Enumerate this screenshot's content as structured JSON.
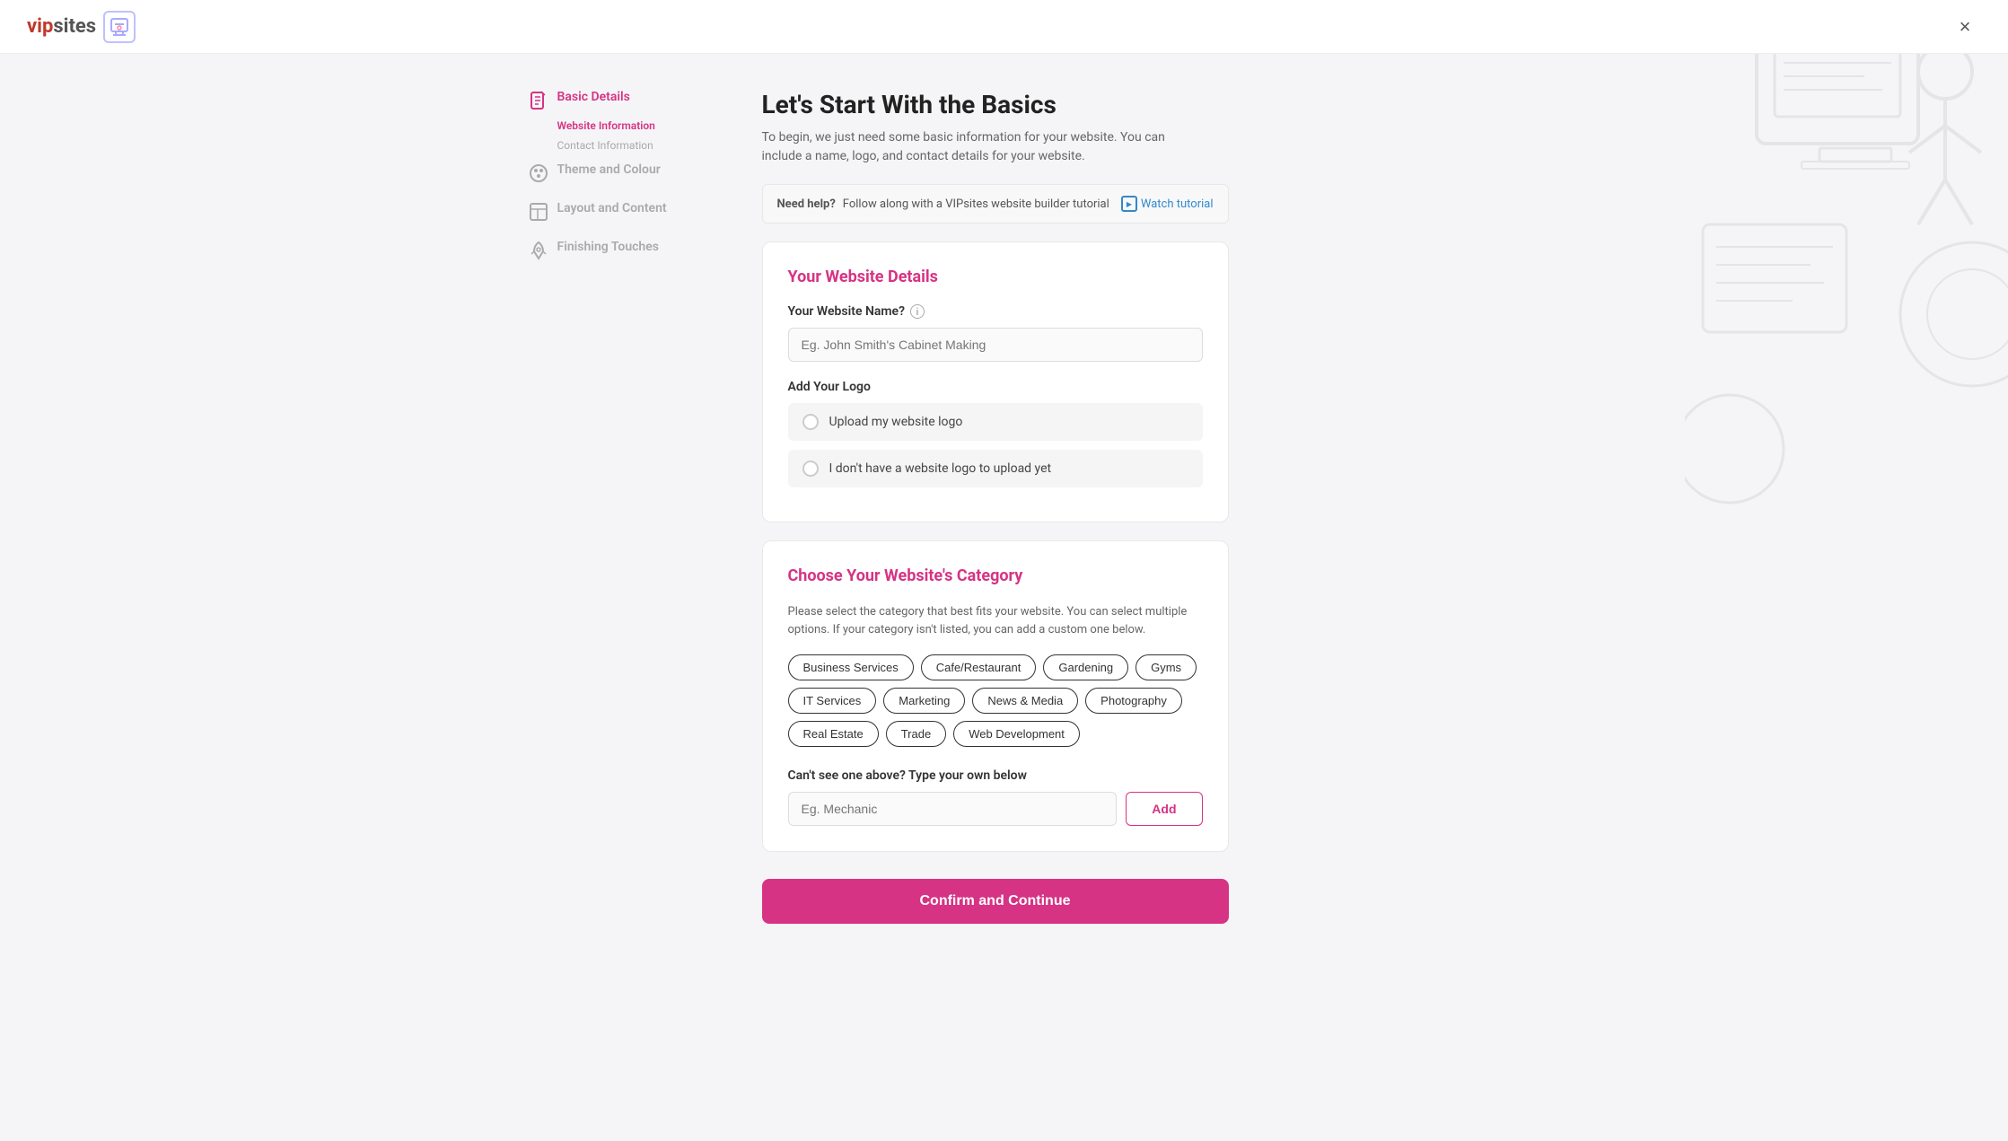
{
  "header": {
    "logo_text_vip": "vip",
    "logo_text_sites": "sites",
    "close_label": "×"
  },
  "sidebar": {
    "items": [
      {
        "id": "basic-details",
        "label": "Basic Details",
        "icon": "document-icon",
        "active": true,
        "sub_items": [
          {
            "label": "Website Information",
            "active": true
          },
          {
            "label": "Contact Information",
            "active": false
          }
        ]
      },
      {
        "id": "theme-colour",
        "label": "Theme and Colour",
        "icon": "palette-icon",
        "active": false,
        "sub_items": []
      },
      {
        "id": "layout-content",
        "label": "Layout and Content",
        "icon": "layout-icon",
        "active": false,
        "sub_items": []
      },
      {
        "id": "finishing-touches",
        "label": "Finishing Touches",
        "icon": "rocket-icon",
        "active": false,
        "sub_items": []
      }
    ]
  },
  "page": {
    "title": "Let's Start With the Basics",
    "subtitle": "To begin, we just need some basic information for your website. You can include a name, logo, and contact details for your website.",
    "help_banner": {
      "text_prefix": "Need help?",
      "text_body": " Follow along with a VIPsites website builder tutorial",
      "watch_label": "Watch tutorial"
    }
  },
  "website_details_card": {
    "title": "Your Website Details",
    "name_label": "Your Website Name?",
    "name_placeholder": "Eg. John Smith's Cabinet Making",
    "logo_label": "Add Your Logo",
    "logo_options": [
      {
        "id": "upload",
        "label": "Upload my website logo"
      },
      {
        "id": "no-logo",
        "label": "I don't have a website logo to upload yet"
      }
    ]
  },
  "category_card": {
    "title": "Choose Your Website's Category",
    "description": "Please select the category that best fits your website. You can select multiple options. If your category isn't listed, you can add a custom one below.",
    "tags": [
      "Business Services",
      "Cafe/Restaurant",
      "Gardening",
      "Gyms",
      "IT Services",
      "Marketing",
      "News & Media",
      "Photography",
      "Real Estate",
      "Trade",
      "Web Development"
    ],
    "custom_label": "Can't see one above? Type your own below",
    "custom_placeholder": "Eg. Mechanic",
    "add_button_label": "Add"
  },
  "confirm_button_label": "Confirm and Continue"
}
